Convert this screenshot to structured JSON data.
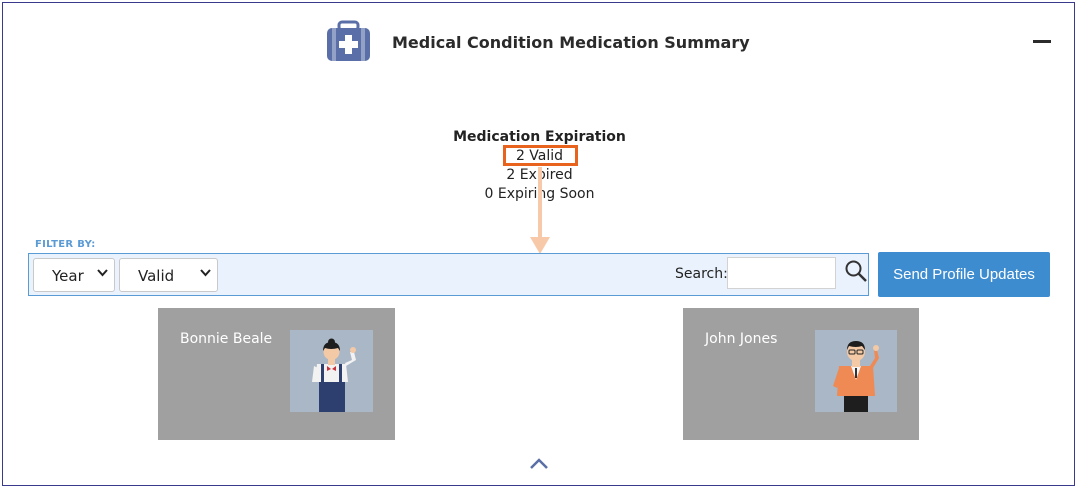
{
  "header": {
    "title": "Medical Condition Medication Summary",
    "icon": "medical-kit-icon",
    "collapse_icon": "minus-icon"
  },
  "summary": {
    "title": "Medication Expiration",
    "valid": "2 Valid",
    "expired": "2 Expired",
    "expiring_soon": "0 Expiring Soon"
  },
  "filter": {
    "label": "FILTER BY:",
    "year_select": "Year",
    "status_select": "Valid",
    "search_label": "Search:",
    "search_value": ""
  },
  "actions": {
    "send_updates": "Send Profile Updates"
  },
  "profiles": [
    {
      "name": "Bonnie Beale"
    },
    {
      "name": "John Jones"
    }
  ],
  "colors": {
    "accent": "#3e8cd0",
    "highlight": "#e8641e",
    "card_bg": "#a0a0a0",
    "icon": "#5a6fa8"
  }
}
